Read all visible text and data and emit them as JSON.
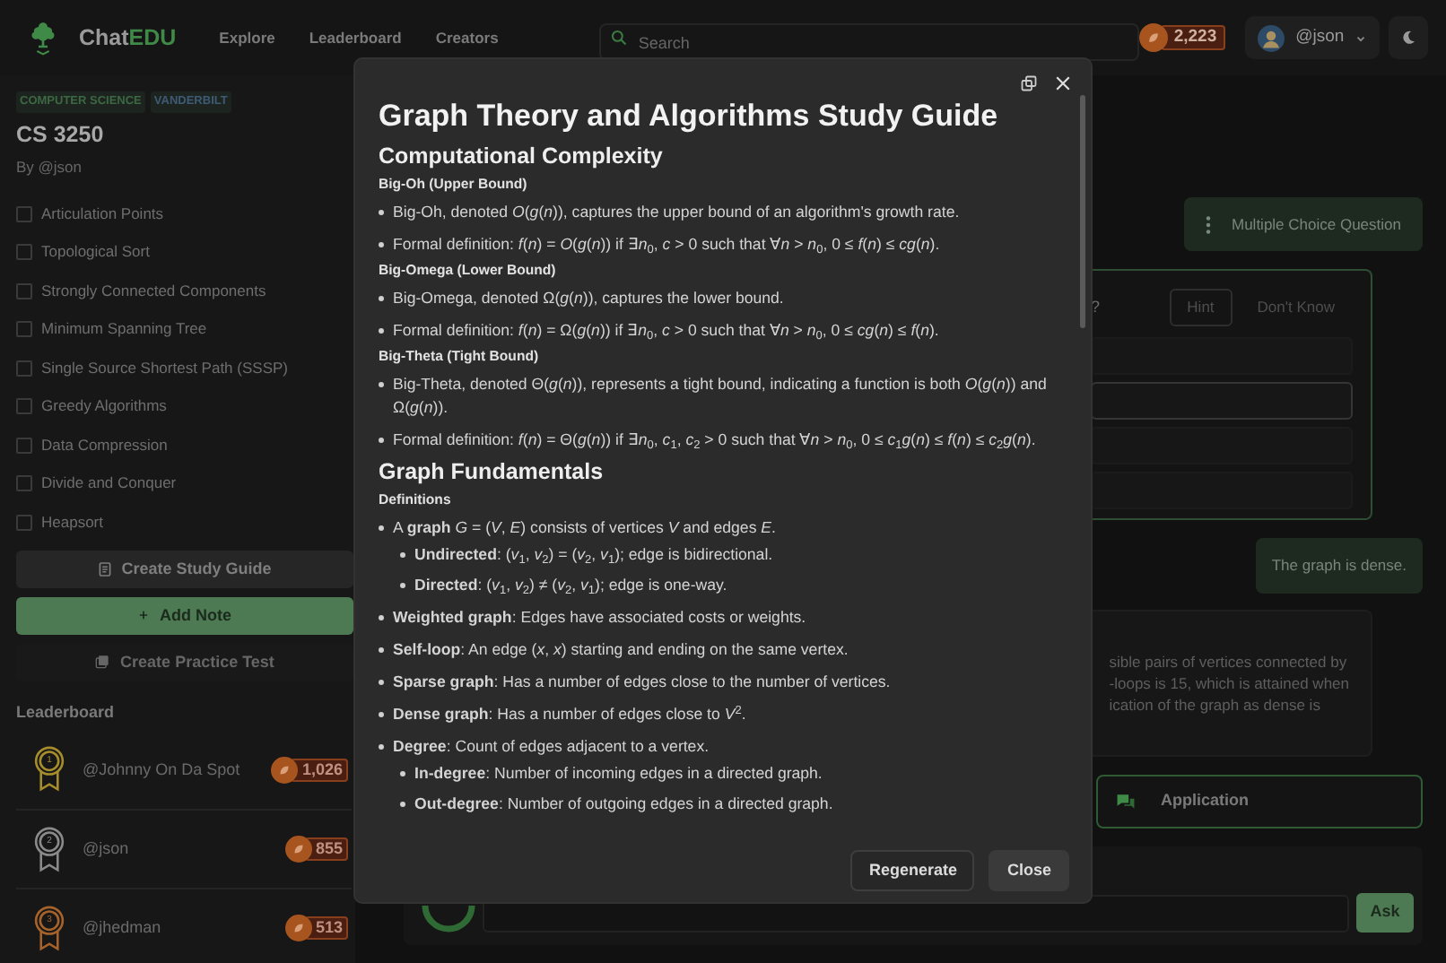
{
  "header": {
    "logo": {
      "text": "Chat",
      "accent": "EDU"
    },
    "nav": [
      {
        "label": "Explore"
      },
      {
        "label": "Leaderboard"
      },
      {
        "label": "Creators"
      }
    ],
    "search": {
      "placeholder": "Search"
    },
    "coins": "2,223",
    "user": "@json"
  },
  "course": {
    "tags": [
      {
        "label": "COMPUTER SCIENCE",
        "color": "#3c6843"
      },
      {
        "label": "VANDERBILT",
        "color": "#3e5a75"
      }
    ],
    "title": "CS 3250",
    "author": "By @json",
    "topics": [
      {
        "label": "Articulation Points",
        "checked": false
      },
      {
        "label": "Topological Sort",
        "checked": false
      },
      {
        "label": "Strongly Connected Components",
        "checked": false
      },
      {
        "label": "Minimum Spanning Tree",
        "checked": false
      },
      {
        "label": "Single Source Shortest Path (SSSP)",
        "checked": false
      },
      {
        "label": "Greedy Algorithms",
        "checked": false
      },
      {
        "label": "Data Compression",
        "checked": false
      },
      {
        "label": "Divide and Conquer",
        "checked": false
      },
      {
        "label": "Heapsort",
        "checked": false
      }
    ],
    "actions": [
      {
        "label": "Create Study Guide",
        "kind": "guide",
        "disabled": false
      },
      {
        "label": "Add Note",
        "kind": "note",
        "disabled": false
      },
      {
        "label": "Create Practice Test",
        "kind": "test",
        "disabled": true
      }
    ]
  },
  "leaderboard": {
    "title": "Leaderboard",
    "rows": [
      {
        "rank": "1",
        "name": "@Johnny On Da Spot",
        "points": "1,026",
        "color": "#a68d2c"
      },
      {
        "rank": "2",
        "name": "@json",
        "points": "855",
        "color": "#8a8a8a"
      },
      {
        "rank": "3",
        "name": "@jhedman",
        "points": "513",
        "color": "#a5622a"
      }
    ]
  },
  "chat": {
    "mode": "Multiple Choice Question",
    "question": {
      "text_tail": "?",
      "buttons": [
        {
          "label": "Hint",
          "kind": "outline"
        },
        {
          "label": "Don't Know",
          "kind": "plain"
        }
      ],
      "options": [
        {
          "selected": false
        },
        {
          "selected": true
        },
        {
          "selected": false
        },
        {
          "selected": false
        }
      ]
    },
    "answer": "The graph is dense.",
    "explanation_lines": [
      "sible pairs of vertices connected by",
      "-loops is 15, which is attained when",
      "ication of the graph as dense is"
    ],
    "next": "Application",
    "ask": "Ask"
  },
  "modal": {
    "title": "Graph Theory and Algorithms Study Guide",
    "sections": [
      {
        "heading": "Computational Complexity",
        "subsections": [
          {
            "heading": "Big-Oh (Upper Bound)",
            "items": [
              {
                "text": "Big-Oh, denoted *O*(*g*(*n*)), captures the upper bound of an algorithm's growth rate."
              },
              {
                "text": "Formal definition: *f*(*n*) = *O*(*g*(*n*)) if ∃*n*$_{0}$, *c* > 0 such that ∀*n* > *n*$_{0}$, 0 ≤ *f*(*n*) ≤ *cg*(*n*)."
              }
            ]
          },
          {
            "heading": "Big-Omega (Lower Bound)",
            "items": [
              {
                "text": "Big-Omega, denoted Ω(*g*(*n*)), captures the lower bound."
              },
              {
                "text": "Formal definition: *f*(*n*) = Ω(*g*(*n*)) if ∃*n*$_{0}$, *c* > 0 such that ∀*n* > *n*$_{0}$, 0 ≤ *cg*(*n*) ≤ *f*(*n*)."
              }
            ]
          },
          {
            "heading": "Big-Theta (Tight Bound)",
            "items": [
              {
                "text": "Big-Theta, denoted Θ(*g*(*n*)), represents a tight bound, indicating a function is both *O*(*g*(*n*)) and Ω(*g*(*n*))."
              },
              {
                "text": "Formal definition: *f*(*n*) = Θ(*g*(*n*)) if ∃*n*$_{0}$, *c*$_{1}$, *c*$_{2}$ > 0 such that ∀*n* > *n*$_{0}$, 0 ≤ *c*$_{1}$*g*(*n*) ≤ *f*(*n*) ≤ *c*$_{2}$*g*(*n*)."
              }
            ]
          }
        ]
      },
      {
        "heading": "Graph Fundamentals",
        "subsections": [
          {
            "heading": "Definitions",
            "items": [
              {
                "text": "A **graph** *G* = (*V*, *E*) consists of vertices *V* and edges *E*.",
                "children": [
                  {
                    "text": "**Undirected**: (*v*$_{1}$, *v*$_{2}$) = (*v*$_{2}$, *v*$_{1}$); edge is bidirectional."
                  },
                  {
                    "text": "**Directed**: (*v*$_{1}$, *v*$_{2}$) ≠ (*v*$_{2}$, *v*$_{1}$); edge is one-way."
                  }
                ]
              },
              {
                "text": "**Weighted graph**: Edges have associated costs or weights."
              },
              {
                "text": "**Self-loop**: An edge (*x*, *x*) starting and ending on the same vertex."
              },
              {
                "text": "**Sparse graph**: Has a number of edges close to the number of vertices."
              },
              {
                "text": "**Dense graph**: Has a number of edges close to *V*$^{2}$."
              },
              {
                "text": "**Degree**: Count of edges adjacent to a vertex.",
                "children": [
                  {
                    "text": "**In-degree**: Number of incoming edges in a directed graph."
                  },
                  {
                    "text": "**Out-degree**: Number of outgoing edges in a directed graph."
                  }
                ]
              }
            ]
          }
        ]
      }
    ],
    "buttons": [
      {
        "label": "Regenerate",
        "kind": "outline"
      },
      {
        "label": "Close",
        "kind": "filled"
      }
    ]
  }
}
